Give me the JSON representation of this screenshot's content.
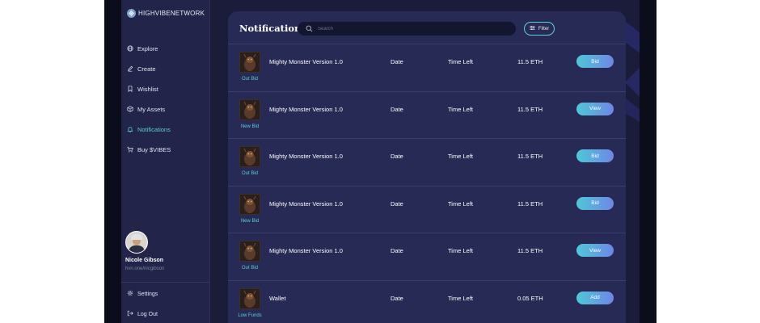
{
  "brand": {
    "name": "HIGHVIBENETWORK"
  },
  "sidebar": {
    "items": [
      {
        "label": "Explore",
        "icon": "globe-icon",
        "active": false
      },
      {
        "label": "Create",
        "icon": "pencil-icon",
        "active": false
      },
      {
        "label": "Wishlist",
        "icon": "bookmark-icon",
        "active": false
      },
      {
        "label": "My Assets",
        "icon": "box-icon",
        "active": false
      },
      {
        "label": "Notifications",
        "icon": "bell-icon",
        "active": true
      },
      {
        "label": "Buy $VIBES",
        "icon": "cart-icon",
        "active": false
      }
    ],
    "settings_label": "Settings",
    "logout_label": "Log Out"
  },
  "user": {
    "name": "Nicole Gibson",
    "handle": "hvn.one/nicgibson"
  },
  "header": {
    "title": "Notifications",
    "search_placeholder": "Search",
    "filter_label": "Filter"
  },
  "notifications": [
    {
      "item": "Mighty Monster Version 1.0",
      "date": "Date",
      "time": "Time Left",
      "price": "11.5 ETH",
      "status": "Out Bid",
      "action": "Bid"
    },
    {
      "item": "Mighty Monster Version 1.0",
      "date": "Date",
      "time": "Time Left",
      "price": "11.5 ETH",
      "status": "New Bid",
      "action": "View"
    },
    {
      "item": "Mighty Monster Version 1.0",
      "date": "Date",
      "time": "Time Left",
      "price": "11.5 ETH",
      "status": "Out Bid",
      "action": "Bid"
    },
    {
      "item": "Mighty Monster Version 1.0",
      "date": "Date",
      "time": "Time Left",
      "price": "11.5 ETH",
      "status": "New Bid",
      "action": "Bid"
    },
    {
      "item": "Mighty Monster Version 1.0",
      "date": "Date",
      "time": "Time Left",
      "price": "11.5 ETH",
      "status": "Out Bid",
      "action": "View"
    },
    {
      "item": "Wallet",
      "date": "Date",
      "time": "Time Left",
      "price": "0.05 ETH",
      "status": "Low Funds",
      "action": "Add"
    }
  ],
  "colors": {
    "accent": "#5ecfd6",
    "panel": "#272a54",
    "sidebar": "#22244a",
    "background": "#1a1c3a"
  }
}
